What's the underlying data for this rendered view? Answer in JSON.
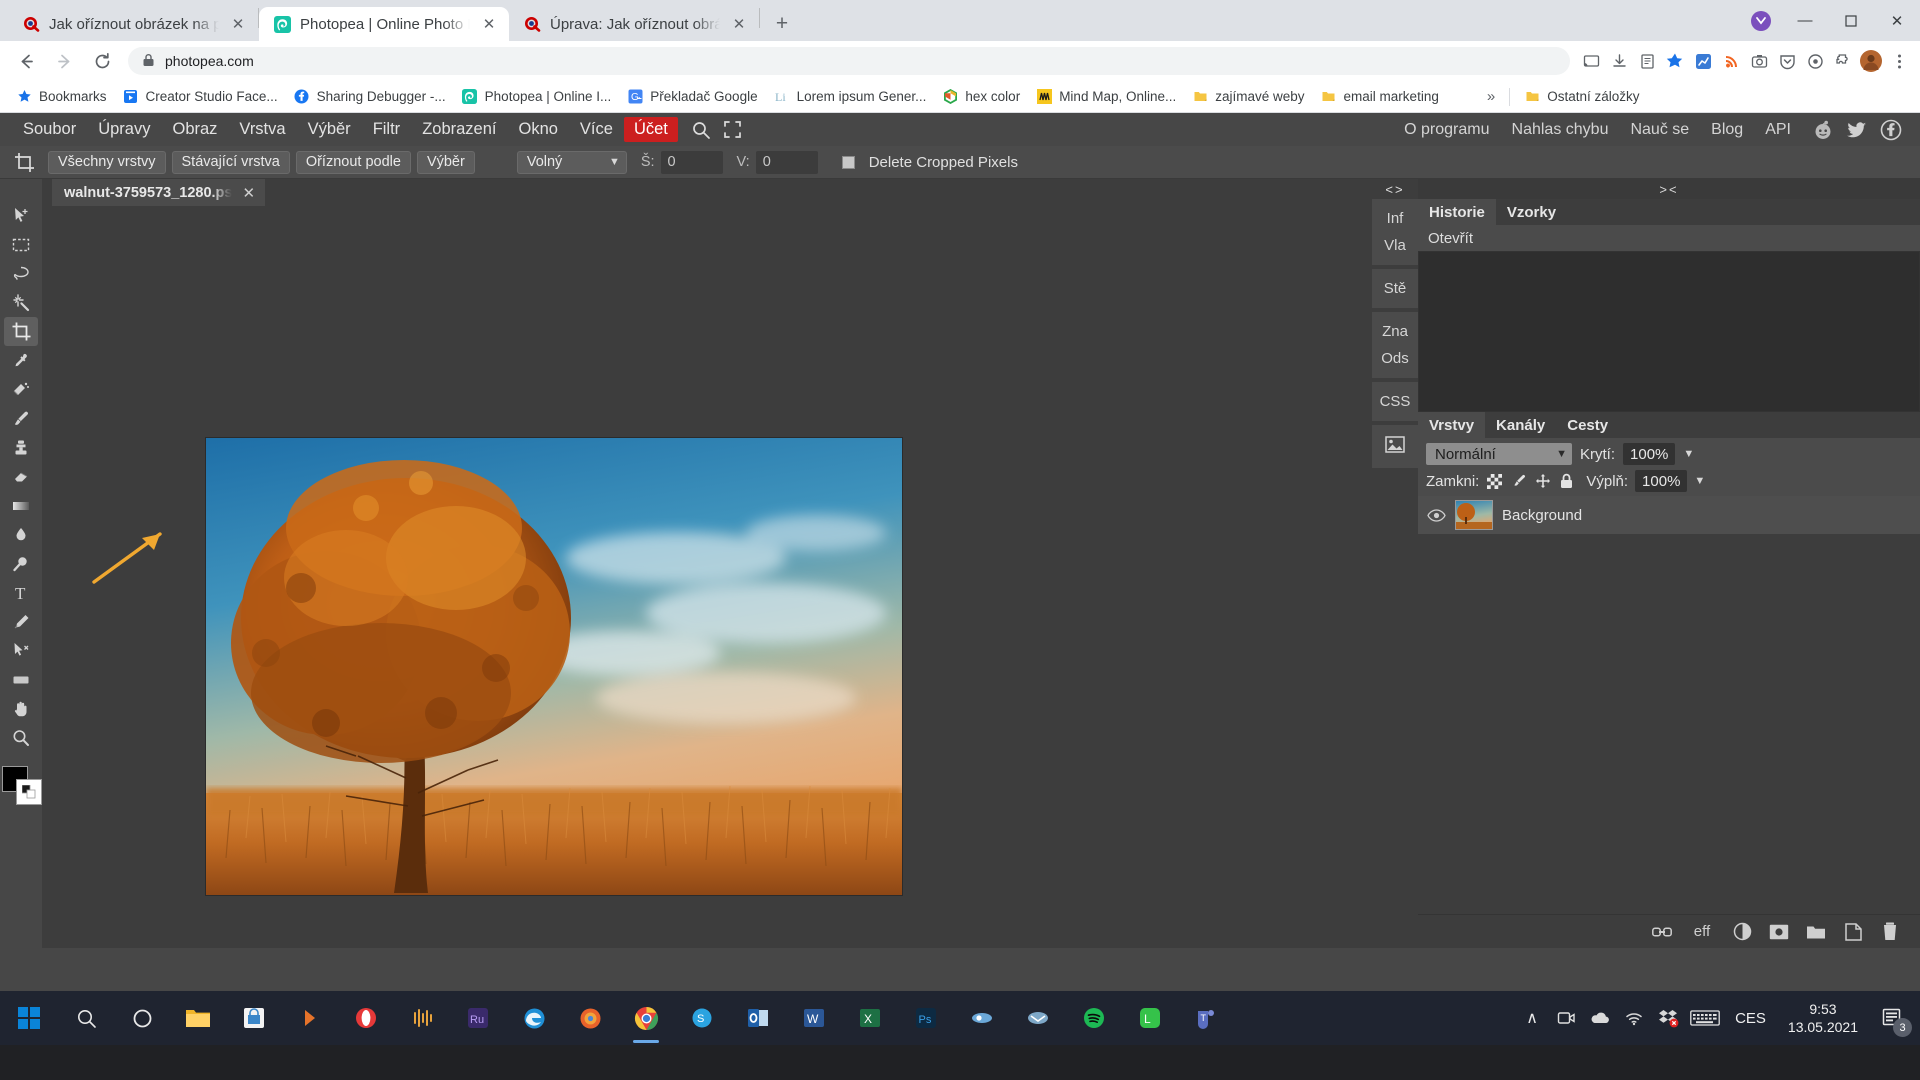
{
  "browser": {
    "tabs": [
      {
        "title": "Jak oříznout obrázek na požadov",
        "favicon": "seznam-icon",
        "active": false
      },
      {
        "title": "Photopea | Online Photo Editor",
        "favicon": "photopea-icon",
        "active": true
      },
      {
        "title": "Úprava: Jak oříznout obrázek na",
        "favicon": "seznam-icon",
        "active": false
      }
    ],
    "newtab_label": "+",
    "window_controls": {
      "minimize": "—",
      "maximize": "☐",
      "close": "✕"
    },
    "nav": {
      "back": "←",
      "forward": "→",
      "reload": "⟳"
    },
    "omnibox": {
      "url": "photopea.com",
      "lock_icon": "lock-icon"
    },
    "toolbar_icons": [
      "cast-icon",
      "download-icon",
      "reading-list-icon",
      "bookmark-star-icon",
      "extension-chart-icon",
      "extension-rss-icon",
      "extension-camera-icon",
      "extension-pocket-icon",
      "extension-circle-icon",
      "extensions-puzzle-icon",
      "avatar-icon",
      "chrome-menu-icon"
    ],
    "bookmarks": [
      {
        "label": "Bookmarks",
        "icon": "star-icon"
      },
      {
        "label": "Creator Studio Face...",
        "icon": "creator-studio-icon"
      },
      {
        "label": "Sharing Debugger -...",
        "icon": "facebook-icon"
      },
      {
        "label": "Photopea | Online I...",
        "icon": "photopea-icon"
      },
      {
        "label": "Překladač Google",
        "icon": "google-translate-icon"
      },
      {
        "label": "Lorem ipsum Gener...",
        "icon": "lorem-ipsum-icon"
      },
      {
        "label": "hex color",
        "icon": "hex-color-icon"
      },
      {
        "label": "Mind Map, Online...",
        "icon": "mindmap-icon"
      },
      {
        "label": "zajímavé weby",
        "icon": "folder-icon"
      },
      {
        "label": "email marketing",
        "icon": "folder-icon"
      }
    ],
    "bookmarks_overflow": "»",
    "other_bookmarks": {
      "label": "Ostatní záložky",
      "icon": "folder-icon"
    }
  },
  "photopea": {
    "menu": [
      "Soubor",
      "Úpravy",
      "Obraz",
      "Vrstva",
      "Výběr",
      "Filtr",
      "Zobrazení",
      "Okno",
      "Více"
    ],
    "account_label": "Účet",
    "menu_icons": [
      "search-icon",
      "fullscreen-icon"
    ],
    "menu_right": [
      "O programu",
      "Nahlas chybu",
      "Nauč se",
      "Blog",
      "API"
    ],
    "social_icons": [
      "reddit-icon",
      "twitter-icon",
      "facebook-icon"
    ],
    "options_bar": {
      "tool_icon": "crop-tool-icon",
      "buttons": [
        "Všechny vrstvy",
        "Stávající vrstva",
        "Oříznout podle",
        "Výběr"
      ],
      "ratio_select": "Volný",
      "width_label": "Š:",
      "width_value": "0",
      "height_label": "V:",
      "height_value": "0",
      "delete_cropped_label": "Delete Cropped Pixels",
      "delete_cropped_checked": false
    },
    "document_tab": {
      "name": "walnut-3759573_1280.ps",
      "close": "✕"
    },
    "tools": [
      "move-tool-icon",
      "rectangular-marquee-icon",
      "lasso-icon",
      "magic-wand-icon",
      "crop-tool-icon",
      "eyedropper-icon",
      "healing-brush-icon",
      "brush-icon",
      "clone-stamp-icon",
      "eraser-icon",
      "gradient-icon",
      "blur-icon",
      "dodge-icon",
      "type-tool-icon",
      "pen-tool-icon",
      "path-select-icon",
      "shape-tool-icon",
      "hand-tool-icon",
      "zoom-tool-icon"
    ],
    "selected_tool": "crop-tool-icon",
    "vstrip": {
      "header": "<>",
      "groups": [
        [
          "Inf",
          "Vla"
        ],
        [
          "Stě"
        ],
        [
          "Zna",
          "Ods"
        ],
        [
          "CSS"
        ],
        [
          "image-icon"
        ]
      ]
    },
    "history_panel": {
      "header": "><",
      "tabs": [
        "Historie",
        "Vzorky"
      ],
      "active_tab": "Historie",
      "items": [
        "Otevřít"
      ]
    },
    "layers_panel": {
      "tabs": [
        "Vrstvy",
        "Kanály",
        "Cesty"
      ],
      "active_tab": "Vrstvy",
      "blend_mode": "Normální",
      "opacity_label": "Krytí:",
      "opacity_value": "100%",
      "lock_label": "Zamkni:",
      "lock_icons": [
        "transparency-lock-icon",
        "paint-lock-icon",
        "move-lock-icon",
        "all-lock-icon"
      ],
      "fill_label": "Výplň:",
      "fill_value": "100%",
      "layers": [
        {
          "name": "Background",
          "visible": true,
          "selected": true
        }
      ],
      "footer_icons": [
        "link-layers-icon",
        "eff",
        "adjustment-layer-icon",
        "layer-mask-icon",
        "new-group-icon",
        "new-layer-icon",
        "delete-layer-icon"
      ],
      "footer_eff_label": "eff"
    }
  },
  "taskbar": {
    "start_icon": "windows-start-icon",
    "items": [
      "search-icon",
      "cortana-icon",
      "file-explorer-icon",
      "microsoft-store-icon",
      "fl-studio-icon",
      "opera-icon",
      "audacity-icon",
      "adobe-rush-icon",
      "edge-icon",
      "firefox-icon",
      "chrome-icon",
      "skype-icon",
      "outlook-icon",
      "word-icon",
      "excel-icon",
      "photoshop-icon",
      "podcast-icon",
      "mail-app-icon",
      "spotify-icon",
      "line-icon",
      "teams-icon"
    ],
    "tray": {
      "show_hidden": "∧",
      "icons": [
        "screen-record-icon",
        "onedrive-icon",
        "wifi-icon",
        "dropbox-icon",
        "keyboard-icon"
      ],
      "language": "CES",
      "time": "9:53",
      "date": "13.05.2021",
      "notifications_count": "3"
    }
  },
  "colors": {
    "chrome_toolbar": "#ffffff",
    "chrome_tabstrip": "#dee1e6",
    "photopea_bg": "#474747",
    "photopea_canvas": "#3d3d3d",
    "photopea_panel": "#4b4b4b",
    "accent_red": "#cc1f1f",
    "taskbar": "#1f2430",
    "arrow_highlight": "#f0a830"
  }
}
